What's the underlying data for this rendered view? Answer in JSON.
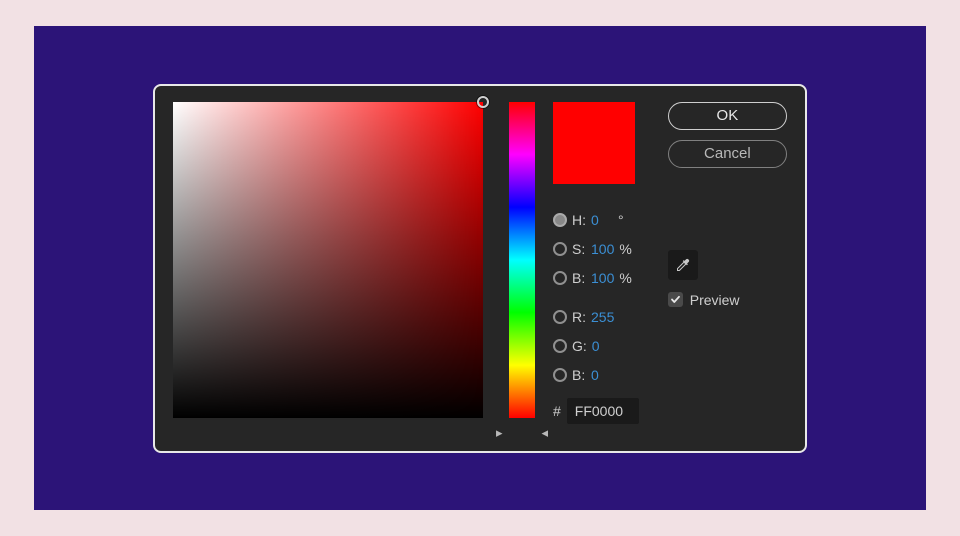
{
  "buttons": {
    "ok": "OK",
    "cancel": "Cancel"
  },
  "swatch_color": "#ff0000",
  "hsb": {
    "h_label": "H:",
    "h_value": "0",
    "h_unit": "°",
    "s_label": "S:",
    "s_value": "100",
    "s_unit": "%",
    "b_label": "B:",
    "b_value": "100",
    "b_unit": "%"
  },
  "rgb": {
    "r_label": "R:",
    "r_value": "255",
    "g_label": "G:",
    "g_value": "0",
    "b_label": "B:",
    "b_value": "0"
  },
  "hex": {
    "label": "#",
    "value": "FF0000"
  },
  "preview": {
    "label": "Preview",
    "checked": true
  },
  "selected_channel": "H"
}
